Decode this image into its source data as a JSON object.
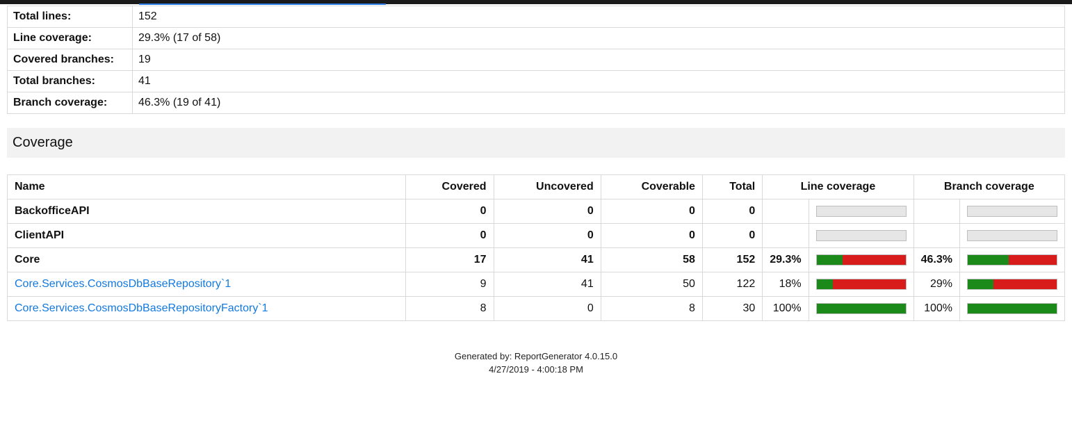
{
  "summary": {
    "rows": [
      {
        "label": "Total lines:",
        "value": "152"
      },
      {
        "label": "Line coverage:",
        "value": "29.3% (17 of 58)"
      },
      {
        "label": "Covered branches:",
        "value": "19"
      },
      {
        "label": "Total branches:",
        "value": "41"
      },
      {
        "label": "Branch coverage:",
        "value": "46.3% (19 of 41)"
      }
    ]
  },
  "section_title": "Coverage",
  "coverage_table": {
    "headers": {
      "name": "Name",
      "covered": "Covered",
      "uncovered": "Uncovered",
      "coverable": "Coverable",
      "total": "Total",
      "line_coverage": "Line coverage",
      "branch_coverage": "Branch coverage"
    },
    "rows": [
      {
        "name": "BackofficeAPI",
        "link": false,
        "bold": true,
        "covered": "0",
        "uncovered": "0",
        "coverable": "0",
        "total": "0",
        "line_pct": "",
        "line_bar": {
          "mode": "empty"
        },
        "branch_pct": "",
        "branch_bar": {
          "mode": "empty"
        }
      },
      {
        "name": "ClientAPI",
        "link": false,
        "bold": true,
        "covered": "0",
        "uncovered": "0",
        "coverable": "0",
        "total": "0",
        "line_pct": "",
        "line_bar": {
          "mode": "empty"
        },
        "branch_pct": "",
        "branch_bar": {
          "mode": "empty"
        }
      },
      {
        "name": "Core",
        "link": false,
        "bold": true,
        "covered": "17",
        "uncovered": "41",
        "coverable": "58",
        "total": "152",
        "line_pct": "29.3%",
        "line_bar": {
          "mode": "split",
          "green": 29.3
        },
        "branch_pct": "46.3%",
        "branch_bar": {
          "mode": "split",
          "green": 46.3
        }
      },
      {
        "name": "Core.Services.CosmosDbBaseRepository`1",
        "link": true,
        "bold": false,
        "covered": "9",
        "uncovered": "41",
        "coverable": "50",
        "total": "122",
        "line_pct": "18%",
        "line_bar": {
          "mode": "split",
          "green": 18
        },
        "branch_pct": "29%",
        "branch_bar": {
          "mode": "split",
          "green": 29
        }
      },
      {
        "name": "Core.Services.CosmosDbBaseRepositoryFactory`1",
        "link": true,
        "bold": false,
        "covered": "8",
        "uncovered": "0",
        "coverable": "8",
        "total": "30",
        "line_pct": "100%",
        "line_bar": {
          "mode": "split",
          "green": 100
        },
        "branch_pct": "100%",
        "branch_bar": {
          "mode": "split",
          "green": 100
        }
      }
    ]
  },
  "footer": {
    "generated_by": "Generated by: ReportGenerator 4.0.15.0",
    "timestamp": "4/27/2019 - 4:00:18 PM"
  }
}
